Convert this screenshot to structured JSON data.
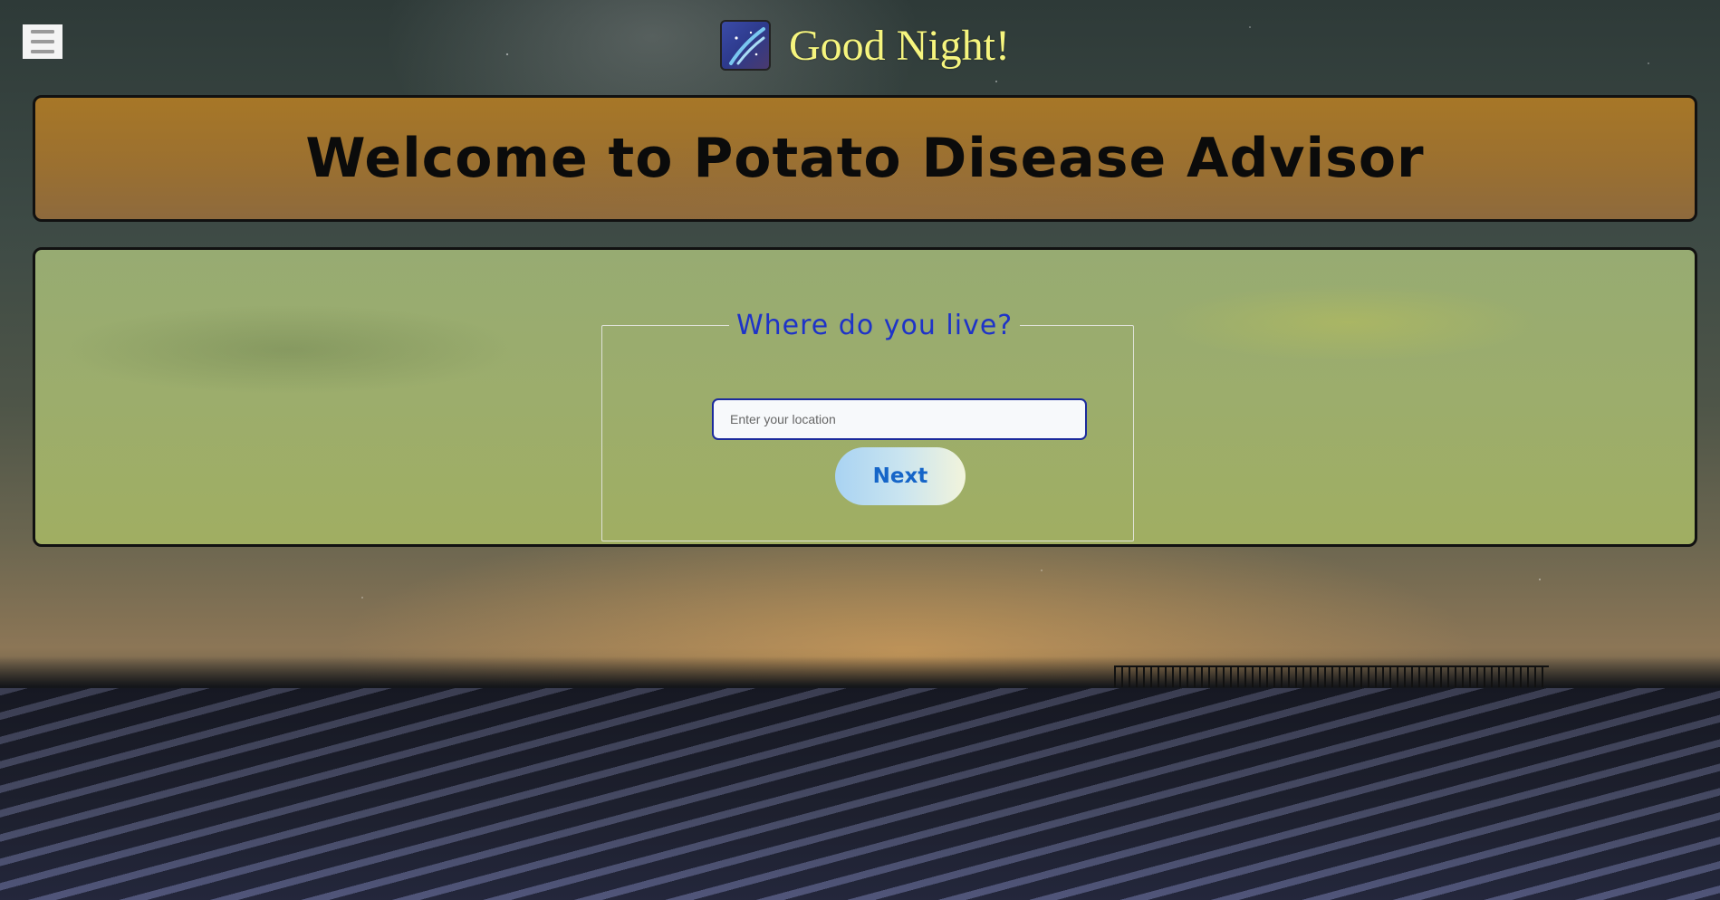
{
  "header": {
    "menu_icon": "hamburger-menu-icon",
    "logo_icon": "night-sky-logo-icon",
    "greeting": "Good Night!",
    "greeting_color": "#f6f57e"
  },
  "welcome": {
    "title": "Welcome to Potato Disease Advisor",
    "panel_color": "#a77727"
  },
  "location_form": {
    "legend": "Where do you live?",
    "legend_color": "#1e33c8",
    "input_placeholder": "Enter your location",
    "input_value": "",
    "next_label": "Next",
    "next_color": "#1565c8",
    "panel_color": "#9cad6c"
  }
}
